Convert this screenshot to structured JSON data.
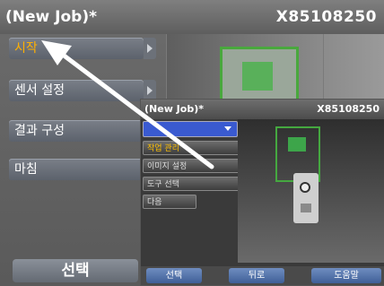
{
  "title": {
    "job": "(New Job)*",
    "serial": "X85108250"
  },
  "sidebar": {
    "items": [
      {
        "label": "시작"
      },
      {
        "label": "센서 설정"
      },
      {
        "label": "결과 구성"
      },
      {
        "label": "마침"
      }
    ],
    "select_label": "선택"
  },
  "inset": {
    "title": {
      "job": "(New Job)*",
      "serial": "X85108250"
    },
    "items": [
      {
        "label": "작업 관리"
      },
      {
        "label": "이미지 설정"
      },
      {
        "label": "도구 선택"
      },
      {
        "label": "다음"
      }
    ],
    "buttons": [
      {
        "label": "선택"
      },
      {
        "label": "뒤로"
      },
      {
        "label": "도움말"
      }
    ]
  },
  "colors": {
    "active_text": "#ffb000",
    "highlight": "#49a83d",
    "arrow": "#ffffff"
  }
}
